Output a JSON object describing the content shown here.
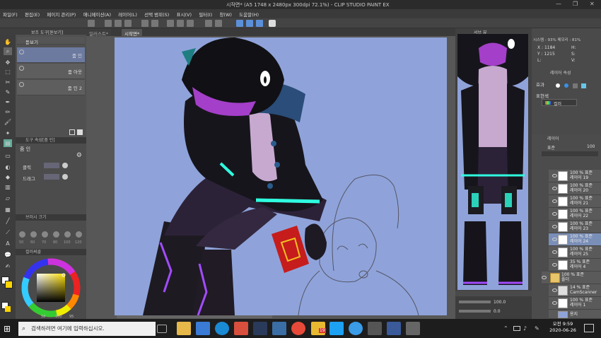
{
  "window": {
    "title": "시작면* (A5 1748 x 2480px 300dpi 72.1%) - CLIP STUDIO PAINT EX",
    "controls": [
      "—",
      "❐",
      "✕"
    ]
  },
  "menu": [
    "파일(F)",
    "편집(E)",
    "페이지 관리(P)",
    "애니메이션(A)",
    "레이어(L)",
    "선택 범위(S)",
    "표시(V)",
    "필터(I)",
    "창(W)",
    "도움말(H)"
  ],
  "toolpanel": {
    "tab_label": "보조 도구[돋보기]",
    "subtools": [
      "돋보기",
      "줌 인",
      "줌 아웃",
      "줌 인 2"
    ]
  },
  "toolprop": {
    "header": "도구 속성[줌 인]",
    "title": "줌 인",
    "click_label": "클릭",
    "drag_label": "드래그"
  },
  "brushsize": {
    "header": "브러시 크기",
    "sizes": [
      "50",
      "60",
      "70",
      "80",
      "100",
      "120"
    ]
  },
  "colorpanel": {
    "header": "컬러써클",
    "values": [
      "58",
      "100",
      "95"
    ],
    "main_color": "#ffffff",
    "sub_color": "#ffd400"
  },
  "doctabs": [
    "일러스트*",
    "시작면*"
  ],
  "navigator": {
    "tab": "내비게이터",
    "zoom": "100.0",
    "angle": "0.0"
  },
  "info": {
    "tab": "서브 뷰",
    "title_line": "시스템 : 93% 메모리 : 81%",
    "x_label": "X : 1184",
    "y_label": "Y : 1215",
    "h_label": "H:",
    "s_label": "S:",
    "v_label": "V:",
    "l_label": "L:"
  },
  "layerprop": {
    "tab": "레이어 속성",
    "effect_label": "효과",
    "color_label": "표현색",
    "color_value": "컬러"
  },
  "layers": {
    "tab": "레이어",
    "blend": "표준",
    "opacity": "100",
    "items": [
      {
        "line1": "100 % 표준",
        "line2": "레이어 19"
      },
      {
        "line1": "100 % 표준",
        "line2": "레이어 20"
      },
      {
        "line1": "100 % 표준",
        "line2": "레이어 21"
      },
      {
        "line1": "100 % 표준",
        "line2": "레이어 22"
      },
      {
        "line1": "100 % 표준",
        "line2": "레이어 23"
      },
      {
        "line1": "100 % 표준",
        "line2": "레이어 24"
      },
      {
        "line1": "100 % 표준",
        "line2": "레이어 25"
      },
      {
        "line1": "35 % 표준",
        "line2": "레이어 4"
      },
      {
        "line1": "100 % 표준",
        "line2": "폴더"
      },
      {
        "line1": "14 % 표준",
        "line2": "CamScanner"
      },
      {
        "line1": "100 % 표준",
        "line2": "레이어 1"
      },
      {
        "line1": "",
        "line2": "용지"
      }
    ]
  },
  "taskbar": {
    "search_placeholder": "검색하려면 여기에 입력하십시오.",
    "badge": "19",
    "time": "오전 9:59",
    "date": "2020-06-26"
  }
}
